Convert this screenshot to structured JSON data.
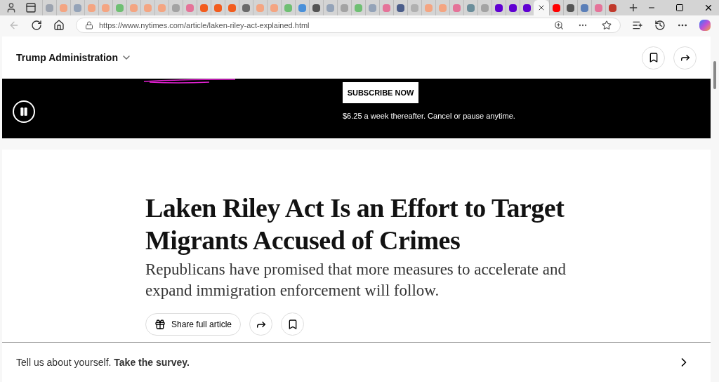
{
  "tabs": [
    {
      "color": "#9ca3af",
      "selected": false
    },
    {
      "color": "#f4a582",
      "selected": false
    },
    {
      "color": "#94a3b8",
      "selected": false
    },
    {
      "color": "#f4a582",
      "selected": false
    },
    {
      "color": "#f4a582",
      "selected": false
    },
    {
      "color": "#6fbf73",
      "selected": false
    },
    {
      "color": "#f4a582",
      "selected": false
    },
    {
      "color": "#f4a582",
      "selected": false
    },
    {
      "color": "#f4a582",
      "selected": false
    },
    {
      "color": "#a3a3a3",
      "selected": false
    },
    {
      "color": "#e57399",
      "selected": false
    },
    {
      "color": "#f25c1e",
      "selected": false
    },
    {
      "color": "#f25c1e",
      "selected": false
    },
    {
      "color": "#f25c1e",
      "selected": false
    },
    {
      "color": "#6b6b6b",
      "selected": false
    },
    {
      "color": "#f4a582",
      "selected": false
    },
    {
      "color": "#f4a582",
      "selected": false
    },
    {
      "color": "#6fbf73",
      "selected": false
    },
    {
      "color": "#4a90d9",
      "selected": false
    },
    {
      "color": "#555555",
      "selected": false
    },
    {
      "color": "#94a3b8",
      "selected": false
    },
    {
      "color": "#a3a3a3",
      "selected": false
    },
    {
      "color": "#6fbf73",
      "selected": false
    },
    {
      "color": "#94a3b8",
      "selected": false
    },
    {
      "color": "#e57399",
      "selected": false
    },
    {
      "color": "#4b5d8a",
      "selected": false
    },
    {
      "color": "#b0b0b0",
      "selected": false
    },
    {
      "color": "#f4a582",
      "selected": false
    },
    {
      "color": "#f4a582",
      "selected": false
    },
    {
      "color": "#e57399",
      "selected": false
    },
    {
      "color": "#6b8e9b",
      "selected": false
    },
    {
      "color": "#a3a3a3",
      "selected": false
    },
    {
      "color": "#6001d2",
      "selected": false
    },
    {
      "color": "#6001d2",
      "selected": false
    },
    {
      "color": "#6001d2",
      "selected": false
    },
    {
      "selected": true
    },
    {
      "color": "#ff0000",
      "selected": false
    },
    {
      "color": "#555555",
      "selected": false
    },
    {
      "color": "#5b7fb8",
      "selected": false
    },
    {
      "color": "#e57399",
      "selected": false
    },
    {
      "color": "#c0392b",
      "selected": false
    }
  ],
  "address": {
    "url": "https://www.nytimes.com/article/laken-riley-act-explained.html"
  },
  "section": {
    "label": "Trump Administration"
  },
  "banner": {
    "button": "SUBSCRIBE NOW",
    "note": "$6.25 a week thereafter. Cancel or pause anytime."
  },
  "article": {
    "headline": "Laken Riley Act Is an Effort to Target Migrants Accused of Crimes",
    "summary": "Republicans have promised that more measures to accelerate and expand immigration enforcement will follow.",
    "share_button": "Share full article"
  },
  "survey": {
    "text": "Tell us about yourself. **Take the survey.**"
  }
}
